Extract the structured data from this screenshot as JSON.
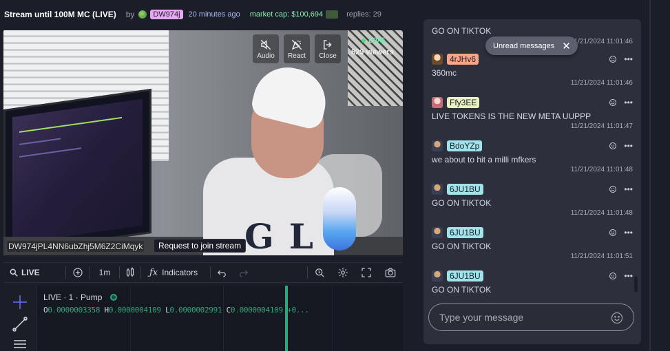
{
  "header": {
    "title": "Stream until 100M MC (LIVE)",
    "by": "by",
    "creator": "DW974j",
    "time_ago": "20 minutes ago",
    "market_cap": "market cap: $100,694",
    "replies": "replies: 29"
  },
  "video": {
    "controls": {
      "audio": "Audio",
      "react": "React",
      "close": "Close"
    },
    "live_label": "LIVE",
    "viewers": "829 viewers",
    "stream_address": "DW974jPL4NN6ubZhj5M6Z2CiMqyk",
    "join_button": "Request to join stream"
  },
  "chart_toolbar": {
    "live_label": "LIVE",
    "interval": "1m",
    "indicators": "Indicators"
  },
  "chart": {
    "legend": "LIVE · 1 · Pump",
    "o_label": "O",
    "o_value": "0.0000003358",
    "h_label": "H",
    "h_value": "0.0000004109",
    "l_label": "L",
    "l_value": "0.0000002991",
    "c_label": "C",
    "c_value": "0.0000004109 +0..."
  },
  "chat": {
    "unread_label": "Unread messages",
    "top_message": {
      "text": "GO ON TIKTOK",
      "time": "11/21/2024 11:01:46"
    },
    "messages": [
      {
        "user": "4rJHv6",
        "text": "360mc",
        "time": "11/21/2024 11:01:46"
      },
      {
        "user": "Ffy3EE",
        "text": "LIVE TOKENS IS THE NEW META UUPPP",
        "time": "11/21/2024 11:01:47"
      },
      {
        "user": "BdoYZp",
        "text": "we about to hit a milli mfkers",
        "time": "11/21/2024 11:01:48"
      },
      {
        "user": "6JU1BU",
        "text": "GO ON TIKTOK",
        "time": "11/21/2024 11:01:48"
      },
      {
        "user": "6JU1BU",
        "text": "GO ON TIKTOK",
        "time": "11/21/2024 11:01:51"
      },
      {
        "user": "6JU1BU",
        "text": "GO ON TIKTOK",
        "time": ""
      }
    ],
    "input_placeholder": "Type your message"
  },
  "colors": {
    "background": "#1b1d28",
    "chat_panel": "#2d2f3c",
    "live_green": "#4ade80",
    "chart_green": "#2fa57b",
    "creator_badge": "#e6a8f0"
  }
}
